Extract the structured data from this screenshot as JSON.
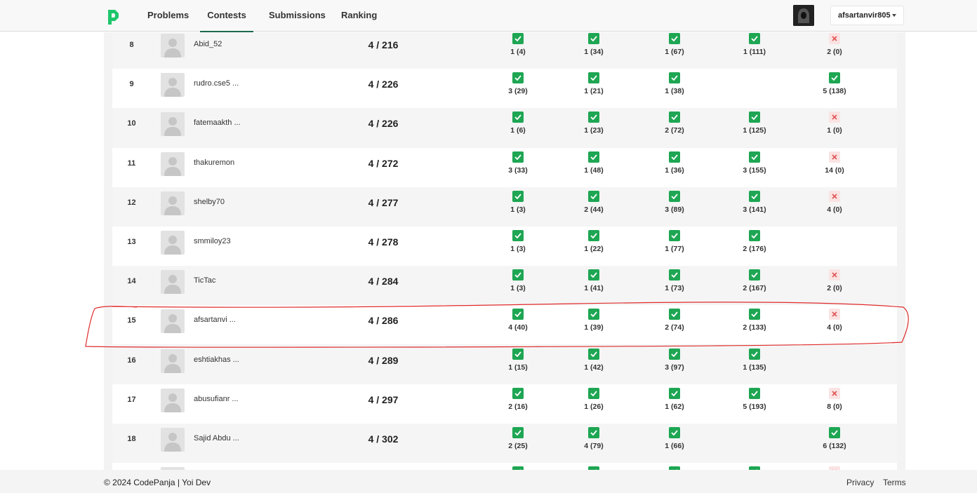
{
  "nav": {
    "tabs": [
      "Problems",
      "Contests",
      "Submissions",
      "Ranking"
    ],
    "active_tab": "Contests",
    "username": "afsartanvir805"
  },
  "ranking": {
    "rows": [
      {
        "rank": "8",
        "name": "Abid_52",
        "score": "4 / 216",
        "cells": [
          {
            "s": "ac",
            "t": "1 (4)"
          },
          {
            "s": "ac",
            "t": "1 (34)"
          },
          {
            "s": "ac",
            "t": "1 (67)"
          },
          {
            "s": "ac",
            "t": "1 (111)"
          },
          {
            "s": "wa",
            "t": "2 (0)"
          }
        ]
      },
      {
        "rank": "9",
        "name": "rudro.cse5 ...",
        "score": "4 / 226",
        "cells": [
          {
            "s": "ac",
            "t": "3 (29)"
          },
          {
            "s": "ac",
            "t": "1 (21)"
          },
          {
            "s": "ac",
            "t": "1 (38)"
          },
          {
            "s": "none",
            "t": ""
          },
          {
            "s": "ac",
            "t": "5 (138)"
          }
        ]
      },
      {
        "rank": "10",
        "name": "fatemaakth ...",
        "score": "4 / 226",
        "cells": [
          {
            "s": "ac",
            "t": "1 (6)"
          },
          {
            "s": "ac",
            "t": "1 (23)"
          },
          {
            "s": "ac",
            "t": "2 (72)"
          },
          {
            "s": "ac",
            "t": "1 (125)"
          },
          {
            "s": "wa",
            "t": "1 (0)"
          }
        ]
      },
      {
        "rank": "11",
        "name": "thakuremon",
        "score": "4 / 272",
        "cells": [
          {
            "s": "ac",
            "t": "3 (33)"
          },
          {
            "s": "ac",
            "t": "1 (48)"
          },
          {
            "s": "ac",
            "t": "1 (36)"
          },
          {
            "s": "ac",
            "t": "3 (155)"
          },
          {
            "s": "wa",
            "t": "14 (0)"
          }
        ]
      },
      {
        "rank": "12",
        "name": "shelby70",
        "score": "4 / 277",
        "cells": [
          {
            "s": "ac",
            "t": "1 (3)"
          },
          {
            "s": "ac",
            "t": "2 (44)"
          },
          {
            "s": "ac",
            "t": "3 (89)"
          },
          {
            "s": "ac",
            "t": "3 (141)"
          },
          {
            "s": "wa",
            "t": "4 (0)"
          }
        ]
      },
      {
        "rank": "13",
        "name": "smmiloy23",
        "score": "4 / 278",
        "cells": [
          {
            "s": "ac",
            "t": "1 (3)"
          },
          {
            "s": "ac",
            "t": "1 (22)"
          },
          {
            "s": "ac",
            "t": "1 (77)"
          },
          {
            "s": "ac",
            "t": "2 (176)"
          },
          {
            "s": "none",
            "t": ""
          }
        ]
      },
      {
        "rank": "14",
        "name": "TicTac",
        "score": "4 / 284",
        "cells": [
          {
            "s": "ac",
            "t": "1 (3)"
          },
          {
            "s": "ac",
            "t": "1 (41)"
          },
          {
            "s": "ac",
            "t": "1 (73)"
          },
          {
            "s": "ac",
            "t": "2 (167)"
          },
          {
            "s": "wa",
            "t": "2 (0)"
          }
        ]
      },
      {
        "rank": "15",
        "name": "afsartanvi ...",
        "score": "4 / 286",
        "cells": [
          {
            "s": "ac",
            "t": "4 (40)"
          },
          {
            "s": "ac",
            "t": "1 (39)"
          },
          {
            "s": "ac",
            "t": "2 (74)"
          },
          {
            "s": "ac",
            "t": "2 (133)"
          },
          {
            "s": "wa",
            "t": "4 (0)"
          }
        ]
      },
      {
        "rank": "16",
        "name": "eshtiakhas ...",
        "score": "4 / 289",
        "cells": [
          {
            "s": "ac",
            "t": "1 (15)"
          },
          {
            "s": "ac",
            "t": "1 (42)"
          },
          {
            "s": "ac",
            "t": "3 (97)"
          },
          {
            "s": "ac",
            "t": "1 (135)"
          },
          {
            "s": "none",
            "t": ""
          }
        ]
      },
      {
        "rank": "17",
        "name": "abusufianr ...",
        "score": "4 / 297",
        "cells": [
          {
            "s": "ac",
            "t": "2 (16)"
          },
          {
            "s": "ac",
            "t": "1 (26)"
          },
          {
            "s": "ac",
            "t": "1 (62)"
          },
          {
            "s": "ac",
            "t": "5 (193)"
          },
          {
            "s": "wa",
            "t": "8 (0)"
          }
        ]
      },
      {
        "rank": "18",
        "name": "Sajid Abdu ...",
        "score": "4 / 302",
        "cells": [
          {
            "s": "ac",
            "t": "2 (25)"
          },
          {
            "s": "ac",
            "t": "4 (79)"
          },
          {
            "s": "ac",
            "t": "1 (66)"
          },
          {
            "s": "none",
            "t": ""
          },
          {
            "s": "ac",
            "t": "6 (132)"
          }
        ]
      },
      {
        "rank": "",
        "name": "",
        "score": "",
        "cells": [
          {
            "s": "ac",
            "t": ""
          },
          {
            "s": "ac",
            "t": ""
          },
          {
            "s": "ac",
            "t": ""
          },
          {
            "s": "ac",
            "t": ""
          },
          {
            "s": "wa",
            "t": ""
          }
        ]
      }
    ]
  },
  "footer": {
    "copyright": "© 2024 CodePanja | Yoi Dev",
    "privacy": "Privacy",
    "terms": "Terms"
  },
  "colors": {
    "accepted": "#1ea653",
    "wrong": "#fbe3e3",
    "wrong_mark": "#e05555",
    "annotation": "#e02a2a",
    "brand": "#1ec66b"
  }
}
